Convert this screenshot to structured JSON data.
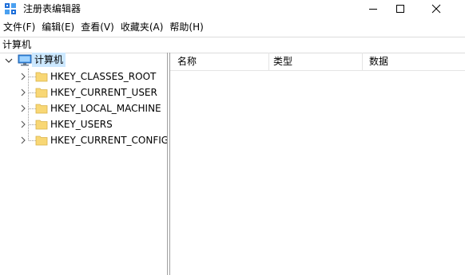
{
  "window": {
    "title": "注册表编辑器"
  },
  "menu": {
    "items": [
      "文件(F)",
      "编辑(E)",
      "查看(V)",
      "收藏夹(A)",
      "帮助(H)"
    ]
  },
  "address": {
    "path": "计算机"
  },
  "tree": {
    "root_label": "计算机",
    "root_icon": "computer-icon",
    "keys": [
      "HKEY_CLASSES_ROOT",
      "HKEY_CURRENT_USER",
      "HKEY_LOCAL_MACHINE",
      "HKEY_USERS",
      "HKEY_CURRENT_CONFIG"
    ],
    "folder_color": "#f8d775",
    "selected_color": "#cce8ff"
  },
  "list": {
    "columns": [
      "名称",
      "类型",
      "数据"
    ]
  }
}
